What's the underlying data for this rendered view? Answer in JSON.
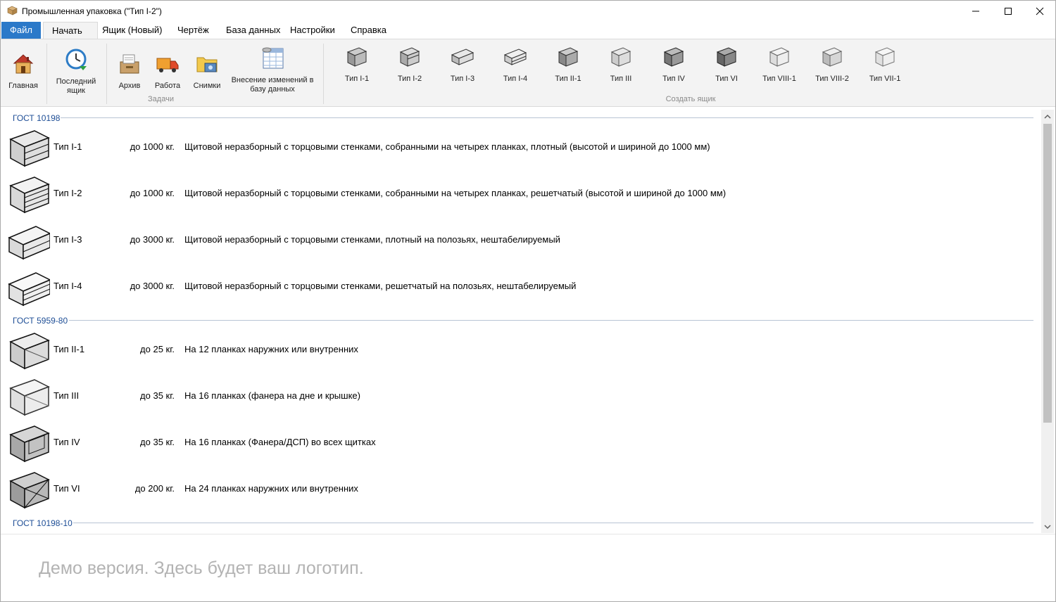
{
  "window": {
    "title": "Промышленная упаковка (\"Тип I-2\")"
  },
  "menu": {
    "tabs": [
      "Файл",
      "Начать",
      "Ящик (Новый)",
      "Чертёж",
      "База данных",
      "Настройки",
      "Справка"
    ]
  },
  "ribbon": {
    "main_label": "Главная",
    "last_box_label": "Последний ящик",
    "archive_label": "Архив",
    "work_label": "Работа",
    "photos_label": "Снимки",
    "db_change_label": "Внесение изменений в базу данных",
    "tasks_group": "Задачи",
    "create_group": "Создать ящик",
    "types": [
      "Тип I-1",
      "Тип I-2",
      "Тип I-3",
      "Тип I-4",
      "Тип II-1",
      "Тип III",
      "Тип IV",
      "Тип VI",
      "Тип VIII-1",
      "Тип VIII-2",
      "Тип VII-1"
    ]
  },
  "list": {
    "groups": [
      {
        "header": "ГОСТ 10198",
        "items": [
          {
            "name": "Тип I-1",
            "load": "до 1000 кг.",
            "desc": "Щитовой неразборный с торцовыми стенками, собранными на четырех планках, плотный (высотой и шириной до 1000 мм)"
          },
          {
            "name": "Тип I-2",
            "load": "до 1000 кг.",
            "desc": "Щитовой неразборный с торцовыми стенками, собранными на четырех планках, решетчатый (высотой и шириной до 1000 мм)"
          },
          {
            "name": "Тип I-3",
            "load": "до 3000 кг.",
            "desc": "Щитовой неразборный с торцовыми стенками, плотный на полозьях, нештабелируемый"
          },
          {
            "name": "Тип I-4",
            "load": "до 3000 кг.",
            "desc": "Щитовой неразборный с торцовыми стенками, решетчатый на полозьях, нештабелируемый"
          }
        ]
      },
      {
        "header": "ГОСТ 5959-80",
        "items": [
          {
            "name": "Тип II-1",
            "load": "до 25 кг.",
            "desc": "На 12 планках наружних или внутренних"
          },
          {
            "name": "Тип III",
            "load": "до 35 кг.",
            "desc": "На 16 планках (фанера на дне и крышке)"
          },
          {
            "name": "Тип IV",
            "load": "до 35 кг.",
            "desc": "На 16 планках (Фанера/ДСП) во всех щитках"
          },
          {
            "name": "Тип VI",
            "load": "до 200 кг.",
            "desc": "На 24 планках наружних или внутренних"
          }
        ]
      },
      {
        "header": "ГОСТ 10198-10",
        "items": []
      }
    ]
  },
  "footer": {
    "logo_text": "Демо версия. Здесь будет ваш логотип."
  },
  "colors": {
    "file_tab": "#2b79c9",
    "ribbon_bg": "#f3f3f3",
    "group_header": "#1e4e96",
    "logo_text": "#b3b3b3"
  }
}
